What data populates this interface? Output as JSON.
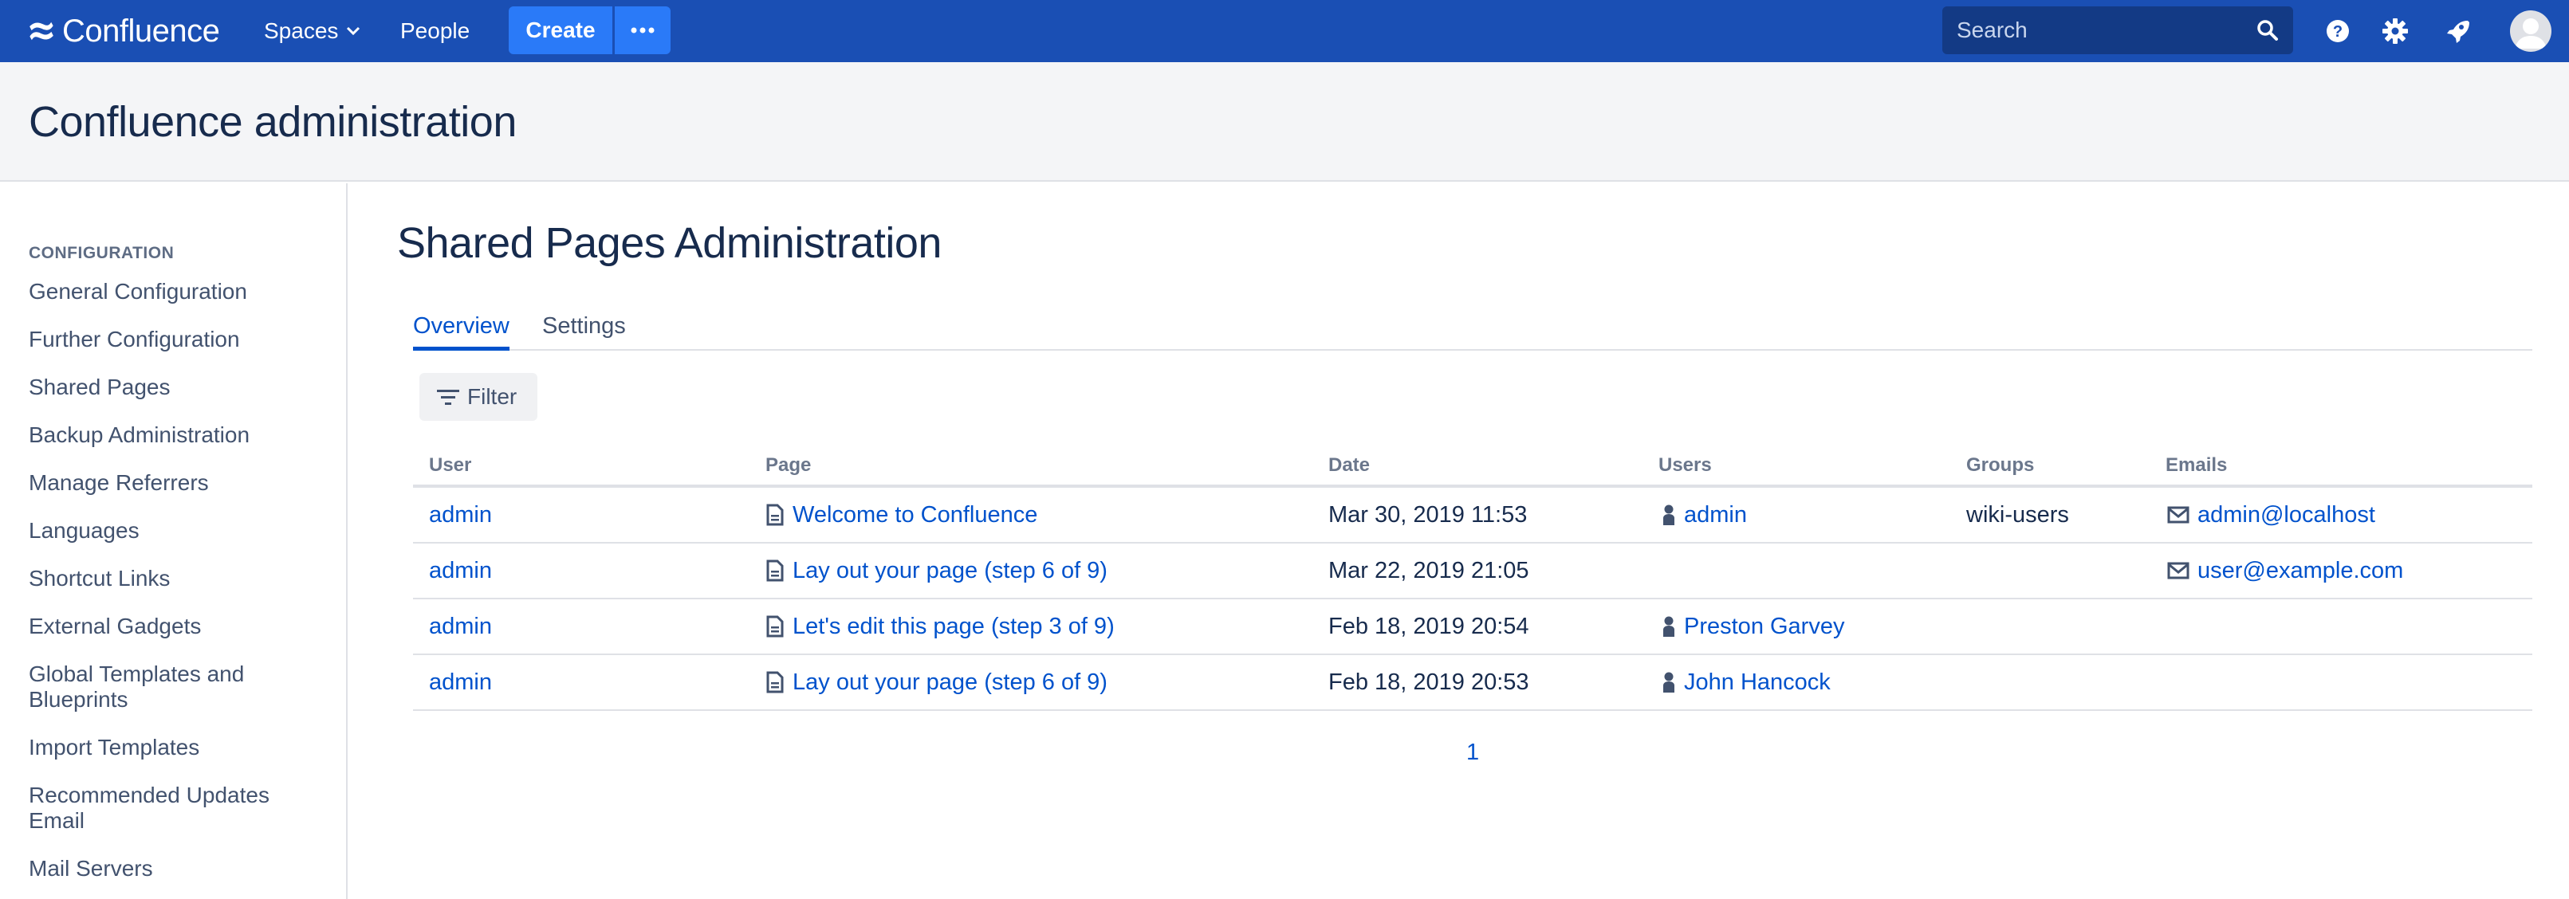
{
  "nav": {
    "logo_text": "Confluence",
    "spaces_label": "Spaces",
    "people_label": "People",
    "create_label": "Create",
    "search_placeholder": "Search",
    "brand_color": "#1a4fb4",
    "icons": [
      "confluence-logo-icon",
      "chevron-down-icon",
      "more-dots-icon",
      "search-icon",
      "help-icon",
      "gear-icon",
      "notifications-rocket-icon",
      "user-avatar-icon"
    ]
  },
  "header": {
    "title": "Confluence administration"
  },
  "sidebar": {
    "section_title": "CONFIGURATION",
    "items": [
      "General Configuration",
      "Further Configuration",
      "Shared Pages",
      "Backup Administration",
      "Manage Referrers",
      "Languages",
      "Shortcut Links",
      "External Gadgets",
      "Global Templates and Blueprints",
      "Import Templates",
      "Recommended Updates Email",
      "Mail Servers"
    ]
  },
  "main": {
    "title": "Shared Pages Administration",
    "tabs": [
      {
        "label": "Overview",
        "active": true
      },
      {
        "label": "Settings",
        "active": false
      }
    ],
    "filter_label": "Filter",
    "columns": [
      "User",
      "Page",
      "Date",
      "Users",
      "Groups",
      "Emails"
    ],
    "rows": [
      {
        "user": "admin",
        "page": "Welcome to Confluence",
        "date": "Mar 30, 2019 11:53",
        "users": "admin",
        "groups": "wiki-users",
        "emails": "admin@localhost"
      },
      {
        "user": "admin",
        "page": "Lay out your page (step 6 of 9)",
        "date": "Mar 22, 2019 21:05",
        "users": "",
        "groups": "",
        "emails": "user@example.com"
      },
      {
        "user": "admin",
        "page": "Let's edit this page (step 3 of 9)",
        "date": "Feb 18, 2019 20:54",
        "users": "Preston Garvey",
        "groups": "",
        "emails": ""
      },
      {
        "user": "admin",
        "page": "Lay out your page (step 6 of 9)",
        "date": "Feb 18, 2019 20:53",
        "users": "John Hancock",
        "groups": "",
        "emails": ""
      }
    ],
    "pagination": "1"
  }
}
